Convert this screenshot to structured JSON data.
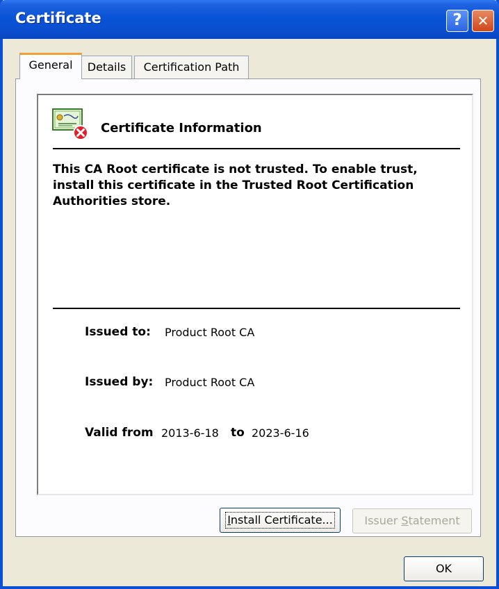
{
  "window": {
    "title": "Certificate",
    "help_glyph": "?",
    "close_glyph": "✕"
  },
  "tabs": [
    {
      "label": "General",
      "active": true
    },
    {
      "label": "Details",
      "active": false
    },
    {
      "label": "Certification Path",
      "active": false
    }
  ],
  "info": {
    "icon": "certificate-untrusted-icon",
    "heading": "Certificate Information",
    "warning": "This CA Root certificate is not trusted. To enable trust, install this certificate in the Trusted Root Certification Authorities store."
  },
  "fields": {
    "issued_to_label": "Issued to:",
    "issued_to_value": "Product Root CA",
    "issued_by_label": "Issued by:",
    "issued_by_value": "Product Root CA",
    "valid_from_label": "Valid from",
    "valid_from_value": "2013-6-18",
    "to_label": "to",
    "valid_to_value": "2023-6-16"
  },
  "buttons": {
    "install_mnemonic": "I",
    "install_rest": "nstall Certificate...",
    "issuer_prefix": "Issuer ",
    "issuer_mnemonic": "S",
    "issuer_rest": "tatement",
    "ok": "OK"
  },
  "colors": {
    "titlebar": "#0854d6",
    "tab_accent": "#f0a030",
    "error_red": "#e0202a"
  }
}
